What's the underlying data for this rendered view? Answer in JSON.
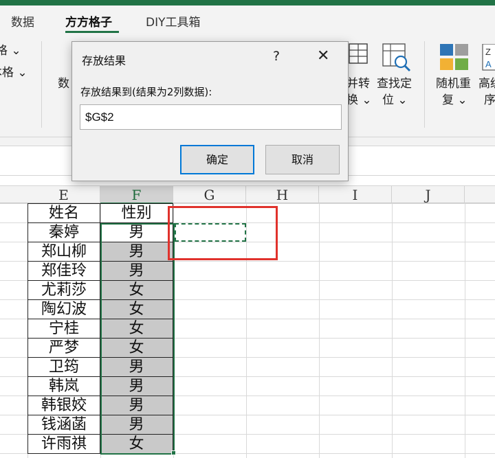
{
  "tabs": {
    "items": [
      {
        "label": "数据"
      },
      {
        "label": "方方格子"
      },
      {
        "label": "DIY工具箱"
      }
    ]
  },
  "ribbon": {
    "left_fragments": [
      "格 ⌄",
      "本格 ⌄"
    ],
    "partial_button": "数",
    "merge_swap": {
      "line1": "并转",
      "line2": "换 ⌄"
    },
    "find_locate": {
      "line1": "查找定",
      "line2": "位 ⌄"
    },
    "random_repeat": {
      "line1": "随机重",
      "line2": "复 ⌄"
    },
    "advanced_sort": {
      "line1": "高级",
      "line2": "序"
    }
  },
  "grid": {
    "columns": [
      "E",
      "F",
      "G",
      "H",
      "I",
      "J"
    ],
    "selected_column": "F",
    "rows": [
      {
        "name": "姓名",
        "gender": "性别"
      },
      {
        "name": "秦婷",
        "gender": "男"
      },
      {
        "name": "郑山柳",
        "gender": "男"
      },
      {
        "name": "郑佳玲",
        "gender": "男"
      },
      {
        "name": "尤莉莎",
        "gender": "女"
      },
      {
        "name": "陶幻波",
        "gender": "女"
      },
      {
        "name": "宁桂",
        "gender": "女"
      },
      {
        "name": "严梦",
        "gender": "女"
      },
      {
        "name": "卫筠",
        "gender": "男"
      },
      {
        "name": "韩岚",
        "gender": "男"
      },
      {
        "name": "韩银姣",
        "gender": "男"
      },
      {
        "name": "钱涵菡",
        "gender": "男"
      },
      {
        "name": "许雨祺",
        "gender": "女"
      }
    ]
  },
  "dialog": {
    "title": "存放结果",
    "help": "?",
    "close": "✕",
    "label": "存放结果到(结果为2列数据):",
    "input_value": "$G$2",
    "ok_label": "确定",
    "cancel_label": "取消"
  },
  "colors": {
    "accent": "#217346",
    "highlight_box": "#e0322c",
    "selection_fill": "#c9c9c9",
    "primary_button_border": "#0078d7"
  }
}
